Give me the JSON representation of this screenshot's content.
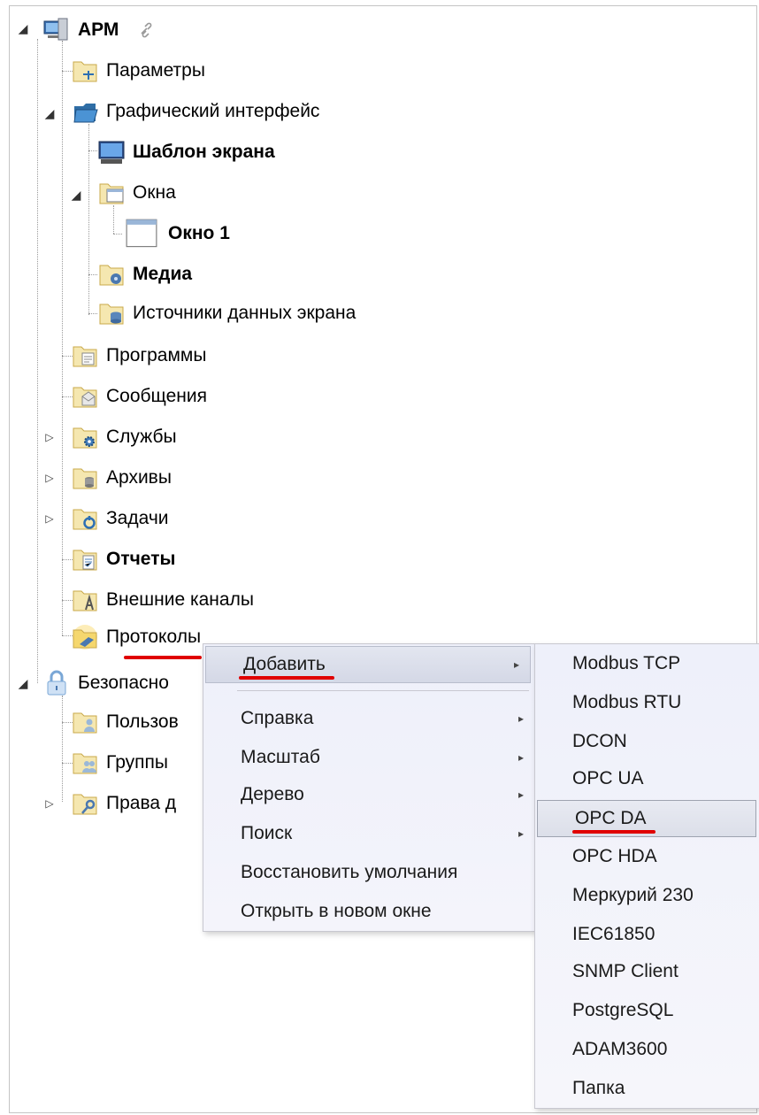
{
  "tree": {
    "root": {
      "label": "АРМ",
      "icon": "workstation-icon",
      "link_icon": "link-icon"
    },
    "items": [
      {
        "label": "Параметры",
        "icon": "parameters-folder-icon"
      },
      {
        "label": "Графический интерфейс",
        "icon": "graphics-folder-icon"
      },
      {
        "label": "Шаблон экрана",
        "icon": "monitor-icon"
      },
      {
        "label": "Окна",
        "icon": "windows-folder-icon"
      },
      {
        "label": "Окно 1",
        "icon": "window-icon"
      },
      {
        "label": "Медиа",
        "icon": "media-folder-icon"
      },
      {
        "label": "Источники данных экрана",
        "icon": "data-sources-folder-icon"
      },
      {
        "label": "Программы",
        "icon": "programs-folder-icon"
      },
      {
        "label": "Сообщения",
        "icon": "messages-folder-icon"
      },
      {
        "label": "Службы",
        "icon": "services-folder-icon"
      },
      {
        "label": "Архивы",
        "icon": "archives-folder-icon"
      },
      {
        "label": "Задачи",
        "icon": "tasks-folder-icon"
      },
      {
        "label": "Отчеты",
        "icon": "reports-folder-icon"
      },
      {
        "label": "Внешние каналы",
        "icon": "external-channels-folder-icon"
      },
      {
        "label": "Протоколы",
        "icon": "protocols-folder-icon"
      },
      {
        "label": "Безопасно",
        "icon": "lock-icon"
      },
      {
        "label": "Пользов",
        "icon": "users-folder-icon"
      },
      {
        "label": "Группы",
        "icon": "groups-folder-icon"
      },
      {
        "label": "Права д",
        "icon": "rights-folder-icon"
      }
    ]
  },
  "context_menu": {
    "items": [
      {
        "label": "Добавить",
        "submenu": true,
        "highlighted": true
      },
      {
        "label": "Справка",
        "submenu": true
      },
      {
        "label": "Масштаб",
        "submenu": true
      },
      {
        "label": "Дерево",
        "submenu": true
      },
      {
        "label": "Поиск",
        "submenu": true
      },
      {
        "label": "Восстановить умолчания",
        "submenu": false
      },
      {
        "label": "Открыть в новом окне",
        "submenu": false
      }
    ],
    "arrow_glyph": "▸"
  },
  "submenu": {
    "items": [
      {
        "label": "Modbus TCP"
      },
      {
        "label": "Modbus RTU"
      },
      {
        "label": "DCON"
      },
      {
        "label": "OPC UA"
      },
      {
        "label": "OPC DA",
        "highlighted": true
      },
      {
        "label": "OPC HDA"
      },
      {
        "label": "Меркурий 230"
      },
      {
        "label": "IEC61850"
      },
      {
        "label": "SNMP Client"
      },
      {
        "label": "PostgreSQL"
      },
      {
        "label": "ADAM3600"
      },
      {
        "label": "Папка"
      }
    ]
  },
  "colors": {
    "annotation_red": "#e00000",
    "folder_yellow": "#f5d76e",
    "menu_bg": "#f0f0f6"
  }
}
